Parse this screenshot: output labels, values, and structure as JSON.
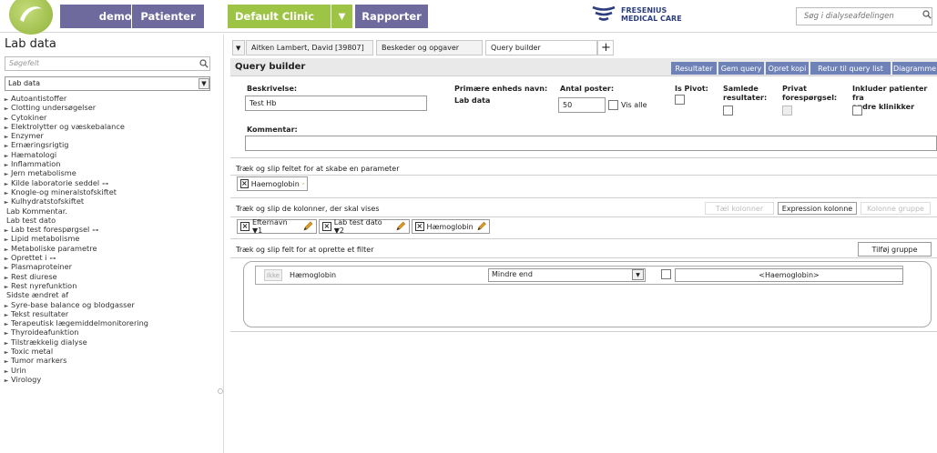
{
  "header": {
    "user_label": "demouser",
    "patients_label": "Patienter",
    "clinic_label": "Default Clinic",
    "clinic_arrow": "▼",
    "reports_label": "Rapporter",
    "brand_line1": "FRESENIUS",
    "brand_line2": "MEDICAL CARE",
    "search_placeholder": "Søg i dialyseafdelingen"
  },
  "left_panel": {
    "title": "Lab data",
    "search_placeholder": "Søgefelt",
    "select_value": "Lab data",
    "tree": [
      {
        "label": "Autoantistoffer",
        "expand": true,
        "link": false
      },
      {
        "label": "Clotting undersøgelser",
        "expand": true,
        "link": false
      },
      {
        "label": "Cytokiner",
        "expand": true,
        "link": false
      },
      {
        "label": "Elektrolytter og væskebalance",
        "expand": true,
        "link": false
      },
      {
        "label": "Enzymer",
        "expand": true,
        "link": false
      },
      {
        "label": "Ernæringsrigtig",
        "expand": true,
        "link": false
      },
      {
        "label": "Hæmatologi",
        "expand": true,
        "link": false
      },
      {
        "label": "Inflammation",
        "expand": true,
        "link": false
      },
      {
        "label": "Jern metabolisme",
        "expand": true,
        "link": false
      },
      {
        "label": "Kilde laboratorie seddel",
        "expand": true,
        "link": true
      },
      {
        "label": "Knogle-og mineralstofskiftet",
        "expand": true,
        "link": false
      },
      {
        "label": "Kulhydratstofskiftet",
        "expand": true,
        "link": false
      },
      {
        "label": "Lab Kommentar.",
        "expand": false,
        "link": false
      },
      {
        "label": "Lab test dato",
        "expand": false,
        "link": false
      },
      {
        "label": "Lab test forespørgsel",
        "expand": true,
        "link": true
      },
      {
        "label": "Lipid metabolisme",
        "expand": true,
        "link": false
      },
      {
        "label": "Metaboliske parametre",
        "expand": true,
        "link": false
      },
      {
        "label": "Oprettet i",
        "expand": true,
        "link": true
      },
      {
        "label": "Plasmaproteiner",
        "expand": true,
        "link": false
      },
      {
        "label": "Rest diurese",
        "expand": true,
        "link": false
      },
      {
        "label": "Rest nyrefunktion",
        "expand": true,
        "link": false
      },
      {
        "label": "Sidste ændret af",
        "expand": false,
        "link": false
      },
      {
        "label": "Syre-base balance og blodgasser",
        "expand": true,
        "link": false
      },
      {
        "label": "Tekst resultater",
        "expand": true,
        "link": false
      },
      {
        "label": "Terapeutisk lægemiddelmonitorering",
        "expand": true,
        "link": false
      },
      {
        "label": "Thyroideafunktion",
        "expand": true,
        "link": false
      },
      {
        "label": "Tilstrækkelig dialyse",
        "expand": true,
        "link": false
      },
      {
        "label": "Toxic metal",
        "expand": true,
        "link": false
      },
      {
        "label": "Tumor markers",
        "expand": true,
        "link": false
      },
      {
        "label": "Urin",
        "expand": true,
        "link": false
      },
      {
        "label": "Virology",
        "expand": true,
        "link": false
      }
    ],
    "expand_glyph": "►",
    "link_glyph": "⊶"
  },
  "tabs": {
    "dropdown": "▼",
    "patient": "Aitken Lambert, David [39807]",
    "messages": "Beskeder og opgaver",
    "query_builder": "Query builder",
    "close": "×",
    "add": "+"
  },
  "query_builder": {
    "title": "Query builder",
    "buttons": {
      "results": "Resultater",
      "save": "Gem query",
      "copy": "Opret kopi",
      "back": "Retur til query list",
      "diagram": "Diagramme"
    },
    "form": {
      "description_label": "Beskrivelse:",
      "description_value": "Test Hb",
      "entity_label": "Primære enheds navn:",
      "entity_value": "Lab data",
      "count_label": "Antal poster:",
      "count_value": "50",
      "show_all_label": "Vis alle",
      "pivot_label": "Is Pivot:",
      "total_label_1": "Samlede",
      "total_label_2": "resultater:",
      "private_label_1": "Privat",
      "private_label_2": "forespørgsel:",
      "include_label_1": "Inkluder patienter fra",
      "include_label_2": "andre klinikker",
      "comment_label": "Kommentar:",
      "comment_value": ""
    },
    "param_section": {
      "label": "Træk og slip feltet for at skabe en parameter",
      "chips": [
        {
          "label": "Haemoglobin"
        }
      ]
    },
    "columns_section": {
      "label": "Træk og slip de kolonner, der skal vises",
      "chips": [
        {
          "label": "Efternavn ▼1"
        },
        {
          "label": "Lab test dato ▼2"
        },
        {
          "label": "Hæmoglobin"
        }
      ],
      "count_columns": "Tæl kolonner",
      "expression_column": "Expression kolonne",
      "column_group": "Kolonne gruppe"
    },
    "filter_section": {
      "label": "Træk og slip felt for at oprette et filter",
      "add_group": "Tilføj gruppe",
      "not_label": "Ikke",
      "field": "Hæmoglobin",
      "operator": "Mindre end",
      "value": "<Haemoglobin>"
    }
  },
  "colors": {
    "nav_purple": "#6e6a9d",
    "clinic_green": "#9ec446",
    "button_blue": "#6e82b8"
  }
}
